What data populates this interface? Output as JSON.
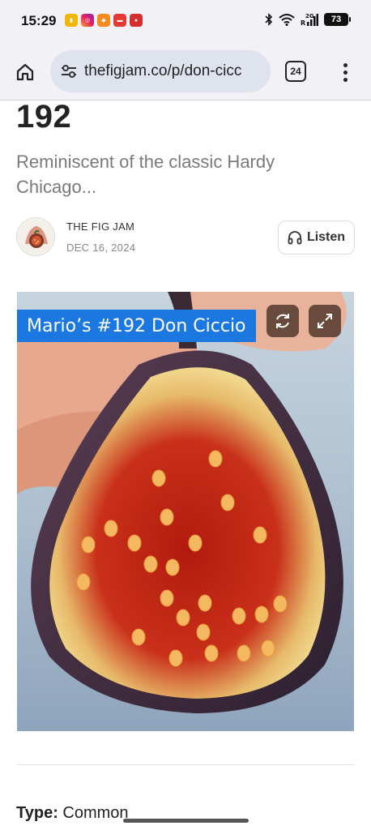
{
  "status_bar": {
    "time": "15:29",
    "battery": "73",
    "notif_icons": [
      "app-notification-1",
      "instagram-icon",
      "app-notification-3",
      "app-notification-4",
      "app-notification-5"
    ],
    "signal_label": "2G"
  },
  "browser": {
    "url": "thefigjam.co/p/don-cicc",
    "tab_count": "24"
  },
  "article": {
    "title": "192",
    "subtitle": "Reminiscent of the classic Hardy Chicago...",
    "author": "THE FIG JAM",
    "date": "DEC 16, 2024",
    "listen_label": "Listen",
    "image_caption": "Mario’s #192 Don Ciccio",
    "type_label": "Type:",
    "type_value": "Common"
  },
  "colors": {
    "caption_bg": "#1b78e0",
    "toolbar_bg": "#f2f2f6",
    "url_bar_bg": "#dfe3ee"
  }
}
